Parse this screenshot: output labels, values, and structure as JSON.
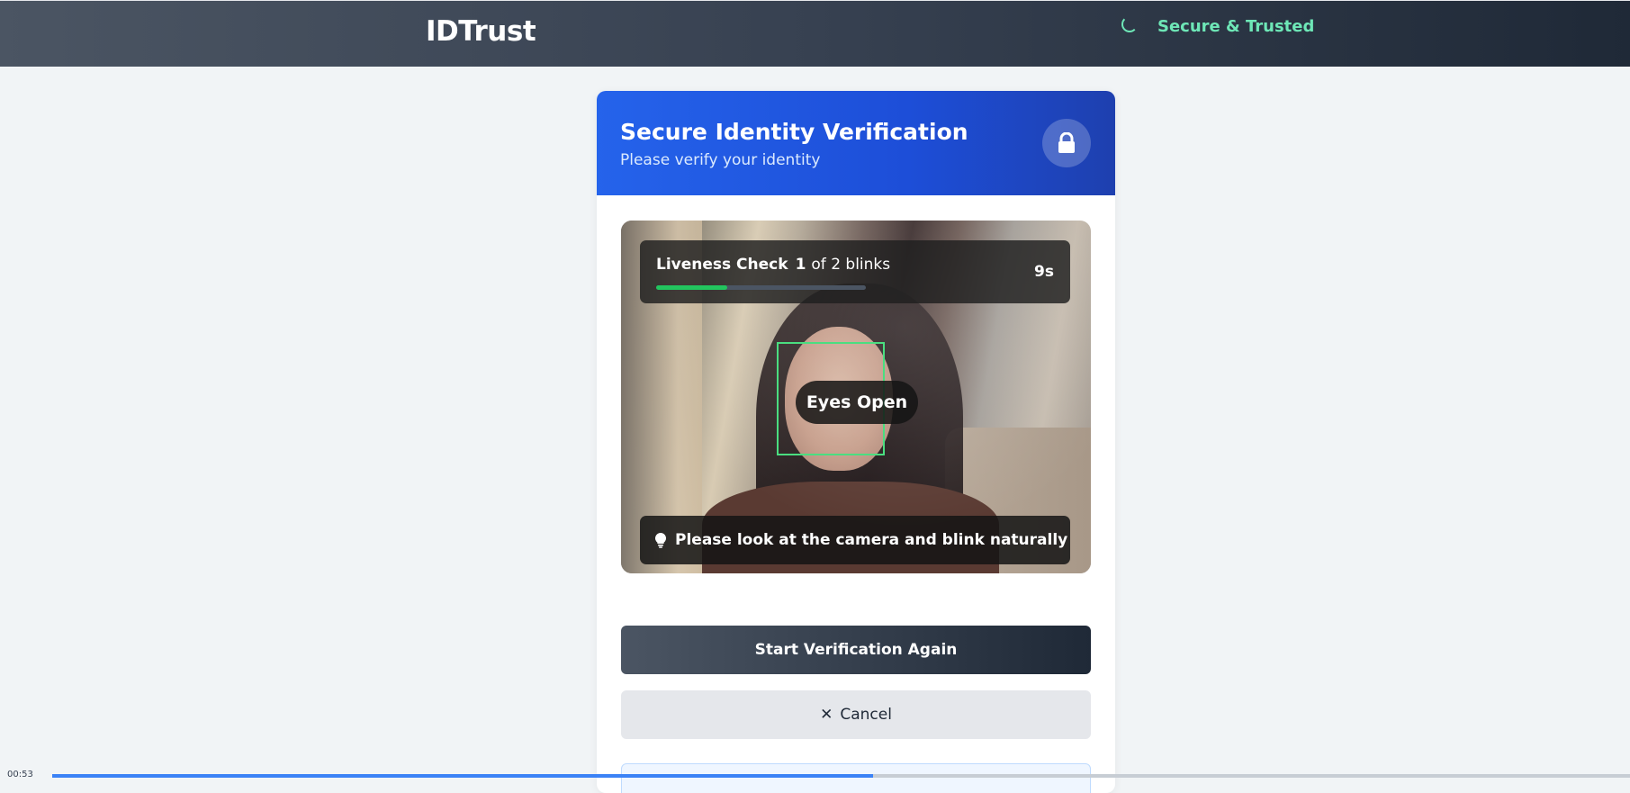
{
  "header": {
    "brand": "IDTrust",
    "secure_label": "Secure & Trusted",
    "secure_icon": "loading-spinner-icon",
    "secure_color": "#6ee7b7"
  },
  "card": {
    "title": "Secure Identity Verification",
    "subtitle": "Please verify your identity",
    "icon": "lock-icon",
    "header_color": "#2563eb"
  },
  "camera": {
    "liveness": {
      "label": "Liveness Check",
      "count": "1",
      "of_text": "of 2 blinks",
      "timer": "9s",
      "progress": 0.34,
      "progress_color": "#22c55e"
    },
    "face_status": "Eyes Open",
    "tip_icon": "lightbulb-icon",
    "tip_text": "Please look at the camera and blink naturally"
  },
  "actions": {
    "primary_label": "Start Verification Again",
    "cancel_label": "Cancel",
    "cancel_icon": "close-icon"
  },
  "video_timeline": {
    "time": "00:53",
    "progress": 0.52,
    "color": "#3b82f6"
  }
}
